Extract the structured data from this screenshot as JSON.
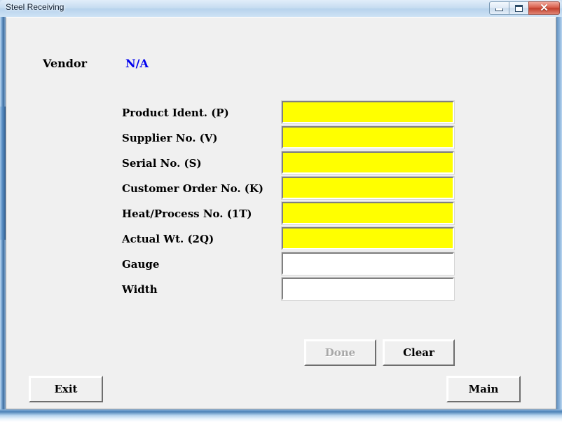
{
  "window": {
    "title": "Steel Receiving",
    "controls": {
      "minimize": "minimize-button",
      "restore": "restore-button",
      "close": "✕"
    }
  },
  "colors": {
    "required_field": "#FFFF00",
    "optional_field": "#FFFFFF",
    "vendor_value": "#0000EE",
    "form_background": "#F0F0F0",
    "disabled_text": "#A8A8A8",
    "close_button": "#C23F2C"
  },
  "form": {
    "vendor": {
      "label": "Vendor",
      "value": "N/A"
    },
    "fields": [
      {
        "label": "Product Ident. (P)",
        "value": "",
        "required": true,
        "name": "product-ident"
      },
      {
        "label": "Supplier No. (V)",
        "value": "",
        "required": true,
        "name": "supplier-no"
      },
      {
        "label": "Serial No. (S)",
        "value": "",
        "required": true,
        "name": "serial-no"
      },
      {
        "label": "Customer Order No. (K)",
        "value": "",
        "required": true,
        "name": "customer-order-no"
      },
      {
        "label": "Heat/Process No. (1T)",
        "value": "",
        "required": true,
        "name": "heat-process-no"
      },
      {
        "label": "Actual Wt. (2Q)",
        "value": "",
        "required": true,
        "name": "actual-wt"
      },
      {
        "label": "Gauge",
        "value": "",
        "required": false,
        "name": "gauge"
      },
      {
        "label": "Width",
        "value": "",
        "required": false,
        "name": "width"
      }
    ],
    "buttons": {
      "done": {
        "label": "Done",
        "disabled": true
      },
      "clear": {
        "label": "Clear",
        "disabled": false
      },
      "exit": {
        "label": "Exit",
        "disabled": false
      },
      "main": {
        "label": "Main",
        "disabled": false
      }
    }
  }
}
